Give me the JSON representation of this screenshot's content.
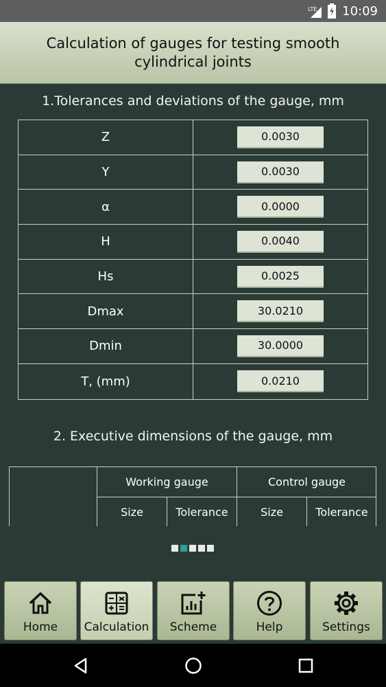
{
  "status_bar": {
    "network": "LTE",
    "time": "10:09"
  },
  "header": {
    "title_line1": "Calculation of gauges for testing smooth",
    "title_line2": "cylindrical joints"
  },
  "section1": {
    "title": "1.Tolerances and deviations of the gauge, mm",
    "rows": [
      {
        "label": "Z",
        "value": "0.0030"
      },
      {
        "label": "Y",
        "value": "0.0030"
      },
      {
        "label": "α",
        "value": "0.0000"
      },
      {
        "label": "H",
        "value": "0.0040"
      },
      {
        "label": "Hs",
        "value": "0.0025"
      },
      {
        "label": "Dmax",
        "value": "30.0210"
      },
      {
        "label": "Dmin",
        "value": "30.0000"
      },
      {
        "label": "T, (mm)",
        "value": "0.0210"
      }
    ]
  },
  "section2": {
    "title": "2. Executive dimensions of the gauge, mm",
    "working_gauge": "Working gauge",
    "control_gauge": "Control gauge",
    "size": "Size",
    "tolerance": "Tolerance"
  },
  "pager": {
    "count": 5,
    "active_index": 1
  },
  "bottom_nav": [
    {
      "label": "Home",
      "icon": "home-icon"
    },
    {
      "label": "Calculation",
      "icon": "calculator-icon",
      "active": true
    },
    {
      "label": "Scheme",
      "icon": "chart-add-icon"
    },
    {
      "label": "Help",
      "icon": "help-icon"
    },
    {
      "label": "Settings",
      "icon": "gear-icon"
    }
  ],
  "android_nav": [
    "back-icon",
    "home-circle-icon",
    "recents-icon"
  ]
}
